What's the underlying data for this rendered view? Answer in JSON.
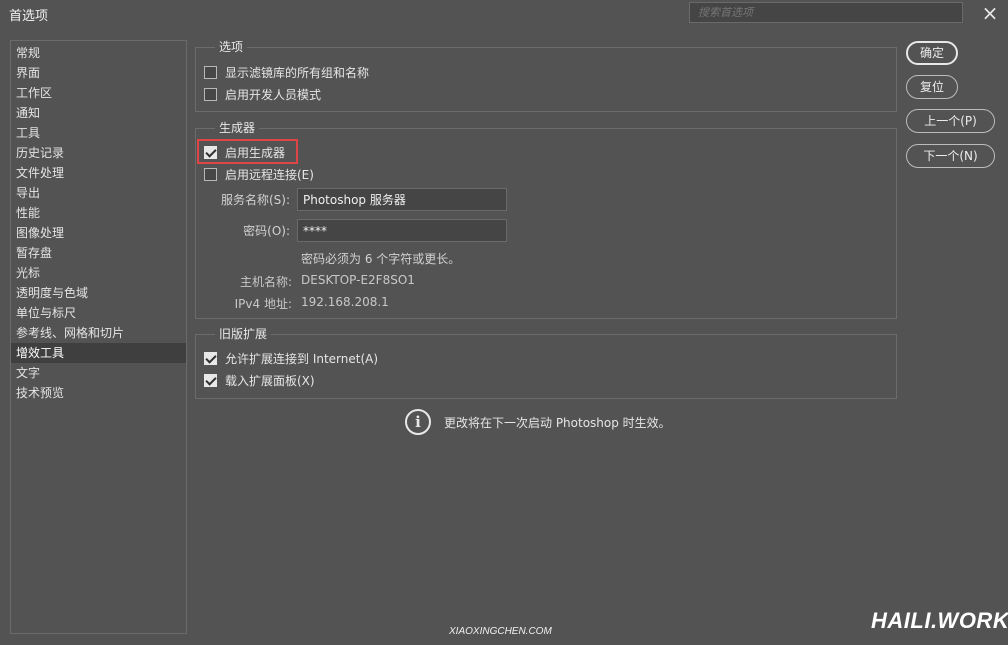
{
  "window": {
    "title": "首选项",
    "search_placeholder": "搜索首选项",
    "close_icon": "×"
  },
  "sidebar": {
    "items": [
      {
        "label": "常规"
      },
      {
        "label": "界面"
      },
      {
        "label": "工作区"
      },
      {
        "label": "通知"
      },
      {
        "label": "工具"
      },
      {
        "label": "历史记录"
      },
      {
        "label": "文件处理"
      },
      {
        "label": "导出"
      },
      {
        "label": "性能"
      },
      {
        "label": "图像处理"
      },
      {
        "label": "暂存盘"
      },
      {
        "label": "光标"
      },
      {
        "label": "透明度与色域"
      },
      {
        "label": "单位与标尺"
      },
      {
        "label": "参考线、网格和切片"
      },
      {
        "label": "增效工具"
      },
      {
        "label": "文字"
      },
      {
        "label": "技术预览"
      }
    ],
    "active": "增效工具"
  },
  "options_group": {
    "title": "选项",
    "show_filter_gallery": {
      "label": "显示滤镜库的所有组和名称",
      "checked": false
    },
    "developer_mode": {
      "label": "启用开发人员模式",
      "checked": false
    }
  },
  "generator_group": {
    "title": "生成器",
    "enable_generator": {
      "label": "启用生成器",
      "checked": true
    },
    "remote_connection": {
      "label": "启用远程连接(E)",
      "checked": false
    },
    "service_name_label": "服务名称(S):",
    "service_name_value": "Photoshop 服务器",
    "password_label": "密码(O):",
    "password_value": "****",
    "password_note": "密码必须为 6 个字符或更长。",
    "hostname_label": "主机名称:",
    "hostname_value": "DESKTOP-E2F8SO1",
    "ipv4_label": "IPv4 地址:",
    "ipv4_value": "192.168.208.1"
  },
  "legacy_group": {
    "title": "旧版扩展",
    "allow_internet": {
      "label": "允许扩展连接到 Internet(A)",
      "checked": true
    },
    "load_panels": {
      "label": "载入扩展面板(X)",
      "checked": true
    }
  },
  "info_message": "更改将在下一次启动 Photoshop 时生效。",
  "buttons": {
    "ok": "确定",
    "reset": "复位",
    "prev": "上一个(P)",
    "next": "下一个(N)"
  },
  "watermarks": {
    "bottom": "XIAOXINGCHEN.COM",
    "corner": "HAILI.WORK"
  },
  "colors": {
    "background": "#535353",
    "field": "#454545",
    "highlight": "#e04545"
  }
}
